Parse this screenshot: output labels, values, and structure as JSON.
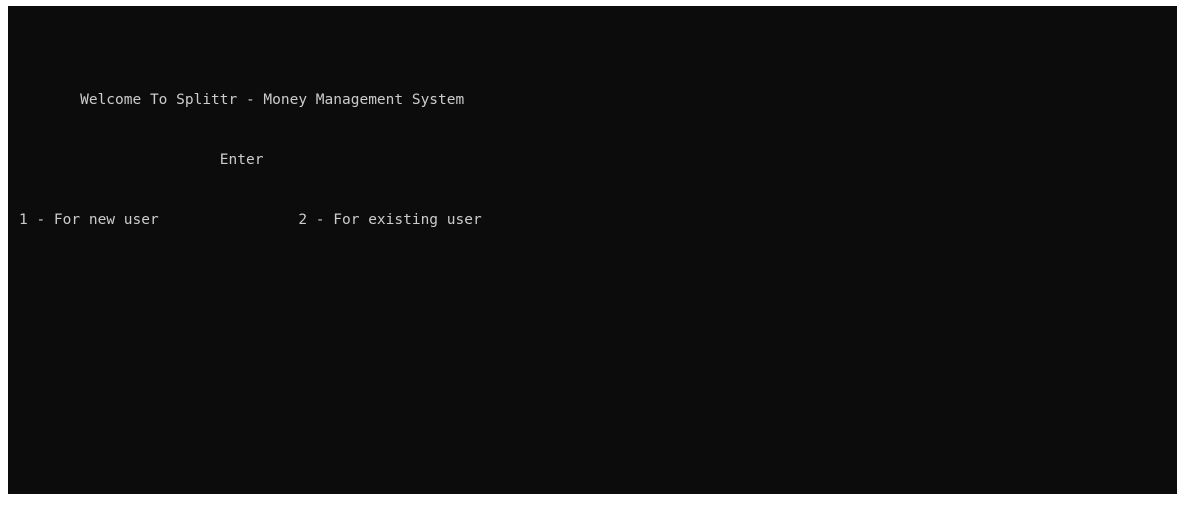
{
  "console": {
    "lines": [
      "       Welcome To Splittr - Money Management System",
      "                       Enter",
      "1 - For new user                2 - For existing user"
    ]
  }
}
